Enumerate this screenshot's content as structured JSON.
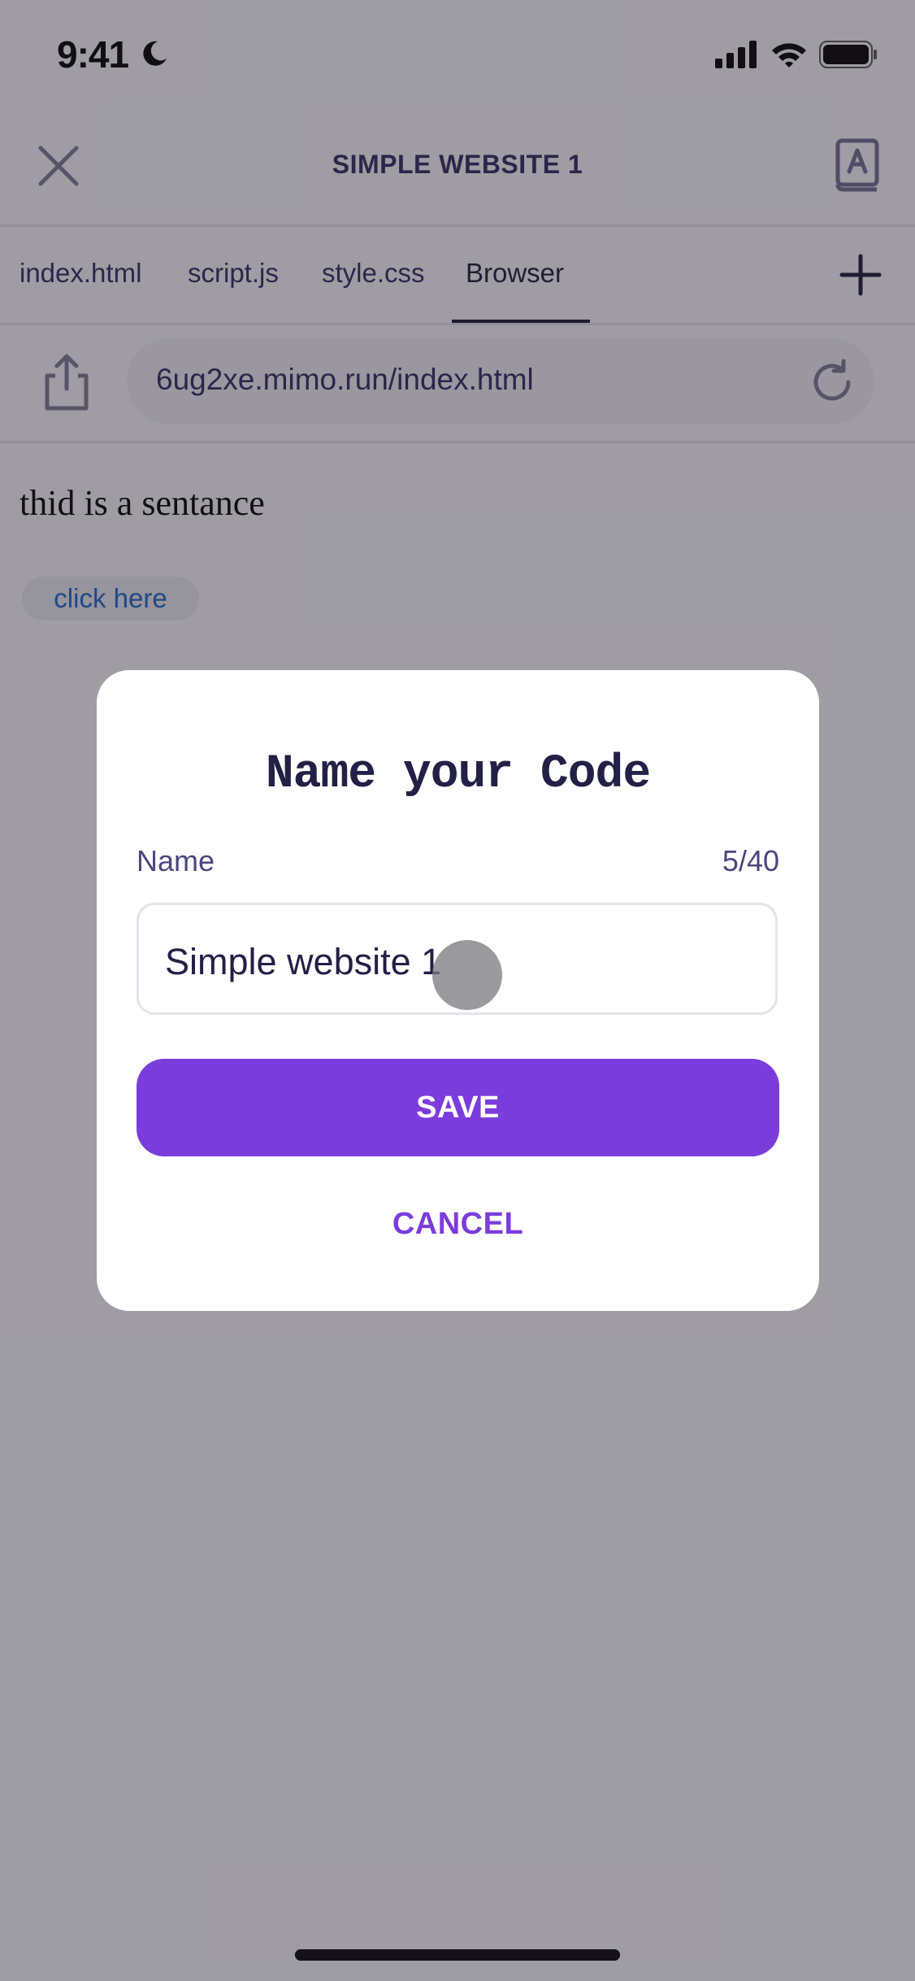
{
  "status_bar": {
    "time": "9:41",
    "icons": [
      "moon-icon",
      "cellular-signal-icon",
      "wifi-icon",
      "battery-icon"
    ]
  },
  "header": {
    "title": "SIMPLE WEBSITE 1",
    "left_icon": "close-icon",
    "right_icon": "glossary-book-icon"
  },
  "tabs": {
    "items": [
      {
        "label": "index.html",
        "active": false
      },
      {
        "label": "script.js",
        "active": false
      },
      {
        "label": "style.css",
        "active": false
      },
      {
        "label": "Browser",
        "active": true
      }
    ],
    "add_icon": "plus-icon"
  },
  "browser": {
    "url": "6ug2xe.mimo.run/index.html",
    "share_icon": "share-icon",
    "reload_icon": "reload-icon"
  },
  "web_content": {
    "sentence": "thid is a sentance",
    "button_label": "click here"
  },
  "modal": {
    "title": "Name your Code",
    "field_label": "Name",
    "char_count": "5/40",
    "input_value": "Simple website 1",
    "save_label": "SAVE",
    "cancel_label": "CANCEL"
  },
  "colors": {
    "accent": "#7b3cdc",
    "title_text": "#2e2a5c",
    "link": "#1a63c9",
    "overlay": "#9a999c"
  }
}
